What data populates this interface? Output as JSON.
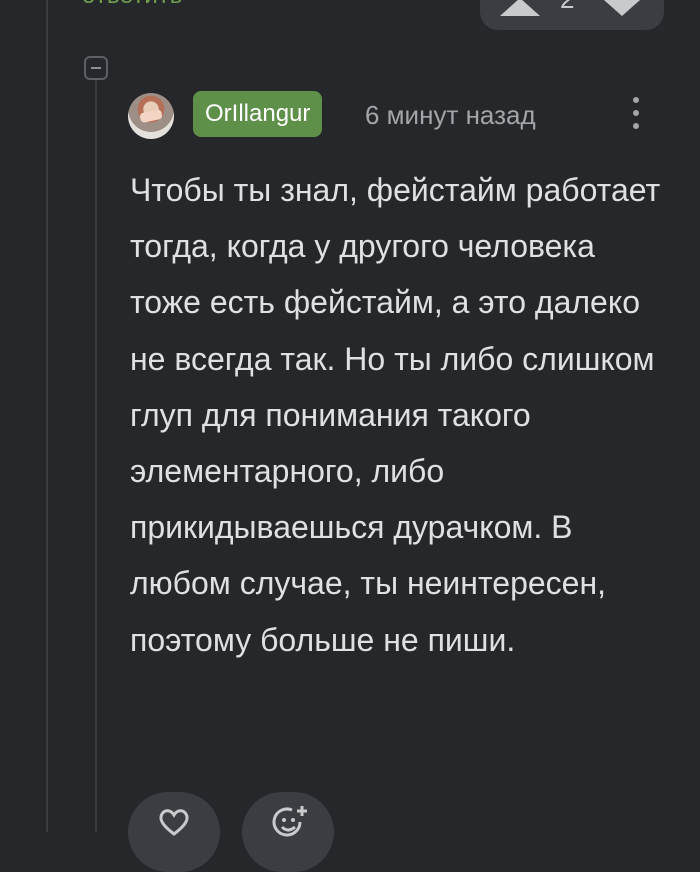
{
  "previous_comment": {
    "reply_label": "ответить",
    "vote_count": "2"
  },
  "comment": {
    "username": "OrIllangur",
    "time_ago": "6 минут назад",
    "text": "Чтобы ты знал, фейстайм работает тогда, когда у другого человека тоже есть фейстайм, а это далеко не всегда так. Но ты либо слишком глуп для понимания такого элементарного, либо прикидываешься дурачком. В любом случае, ты неинтересен, поэтому больше не пиши."
  },
  "actions": {
    "like_icon": "heart-icon",
    "react_icon": "add-reaction-icon"
  },
  "colors": {
    "background": "#25272b",
    "accent_green": "#5e904a",
    "reply_green": "#6f9e4f",
    "text": "#dfe0e2",
    "muted": "#a3a5a9"
  }
}
